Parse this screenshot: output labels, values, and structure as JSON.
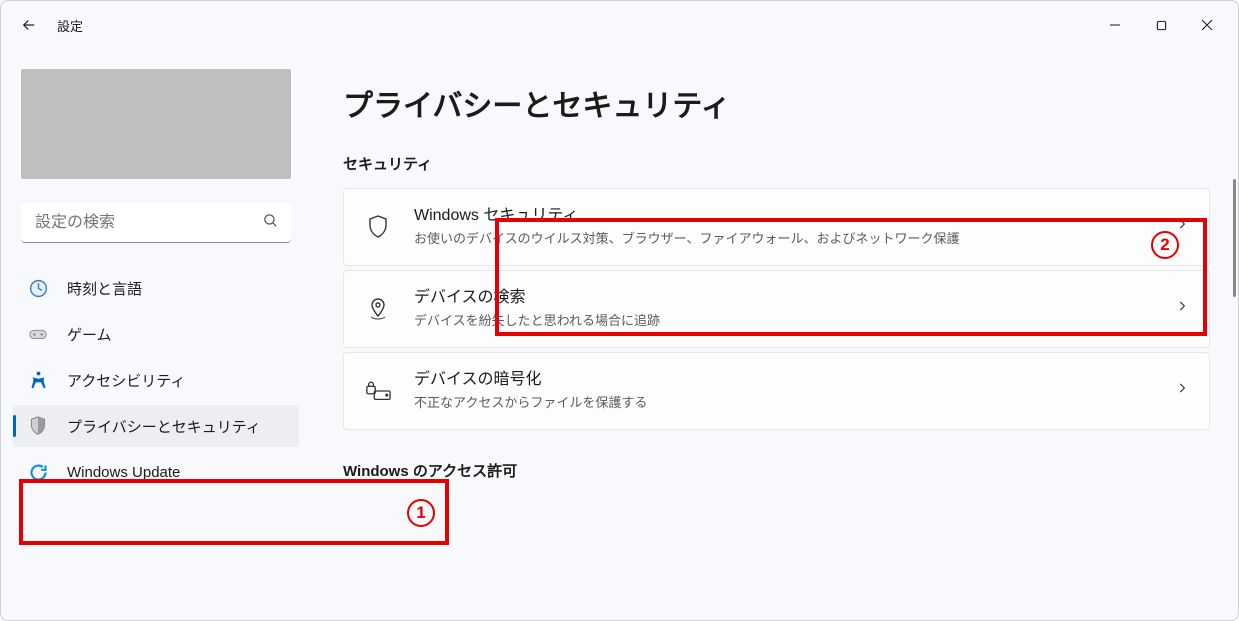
{
  "window": {
    "app_title": "設定",
    "controls": {
      "minimize": "−",
      "maximize": "▢",
      "close": "✕"
    }
  },
  "sidebar": {
    "search_placeholder": "設定の検索",
    "items": [
      {
        "label": "時刻と言語"
      },
      {
        "label": "ゲーム"
      },
      {
        "label": "アクセシビリティ"
      },
      {
        "label": "プライバシーとセキュリティ"
      },
      {
        "label": "Windows Update"
      }
    ]
  },
  "main": {
    "page_title": "プライバシーとセキュリティ",
    "section1_label": "セキュリティ",
    "cards": [
      {
        "title": "Windows セキュリティ",
        "desc": "お使いのデバイスのウイルス対策、ブラウザー、ファイアウォール、およびネットワーク保護"
      },
      {
        "title": "デバイスの検索",
        "desc": "デバイスを紛失したと思われる場合に追跡"
      },
      {
        "title": "デバイスの暗号化",
        "desc": "不正なアクセスからファイルを保護する"
      }
    ],
    "section2_label": "Windows のアクセス許可"
  },
  "annotations": {
    "num1": "1",
    "num2": "2"
  },
  "colors": {
    "accent": "#0067c0",
    "annotation": "#e60000"
  }
}
